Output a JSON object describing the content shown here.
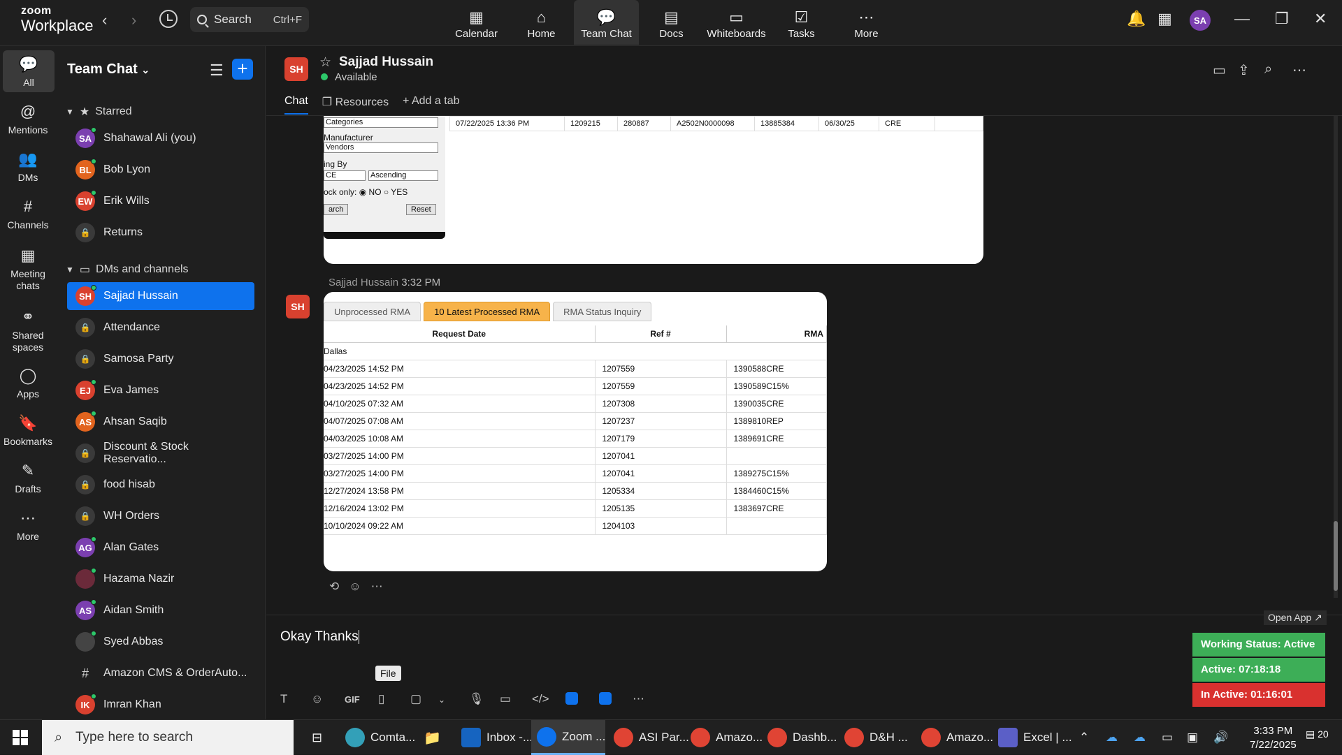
{
  "app": {
    "logo_top": "zoom",
    "logo_bottom": "Workplace"
  },
  "search": {
    "label": "Search",
    "shortcut": "Ctrl+F"
  },
  "top_tabs": [
    {
      "label": "Calendar",
      "icon": "calendar-icon",
      "glyph": "▦"
    },
    {
      "label": "Home",
      "icon": "home-icon",
      "glyph": "⌂"
    },
    {
      "label": "Team Chat",
      "icon": "chat-icon",
      "glyph": "💬"
    },
    {
      "label": "Docs",
      "icon": "docs-icon",
      "glyph": "▤"
    },
    {
      "label": "Whiteboards",
      "icon": "whiteboard-icon",
      "glyph": "▭"
    },
    {
      "label": "Tasks",
      "icon": "tasks-icon",
      "glyph": "☑"
    },
    {
      "label": "More",
      "icon": "more-icon",
      "glyph": "⋯"
    }
  ],
  "user_avatar": "SA",
  "left_nav": [
    {
      "label": "All",
      "glyph": "💬",
      "icon": "all-chat-icon"
    },
    {
      "label": "Mentions",
      "glyph": "@",
      "icon": "mentions-icon"
    },
    {
      "label": "DMs",
      "glyph": "👥",
      "icon": "dms-icon"
    },
    {
      "label": "Channels",
      "glyph": "#",
      "icon": "channels-icon"
    },
    {
      "label": "Meeting chats",
      "glyph": "▦",
      "icon": "meeting-chats-icon"
    },
    {
      "label": "Shared spaces",
      "glyph": "⚭",
      "icon": "shared-spaces-icon"
    },
    {
      "label": "Apps",
      "glyph": "◯",
      "icon": "apps-icon"
    },
    {
      "label": "Bookmarks",
      "glyph": "🔖",
      "icon": "bookmarks-icon"
    },
    {
      "label": "Drafts",
      "glyph": "✎",
      "icon": "drafts-icon"
    },
    {
      "label": "More",
      "glyph": "⋯",
      "icon": "more-icon"
    }
  ],
  "sidebar": {
    "title": "Team Chat",
    "starred_label": "Starred",
    "dms_label": "DMs and channels",
    "starred": [
      {
        "name": "Shahawal Ali (you)",
        "type": "avatar",
        "initials": "SA",
        "color": "#7b3fb0"
      },
      {
        "name": "Bob Lyon",
        "type": "avatar",
        "initials": "BL",
        "color": "#e2641e"
      },
      {
        "name": "Erik Wills",
        "type": "avatar",
        "initials": "EW",
        "color": "#d9412f"
      },
      {
        "name": "Returns",
        "type": "lock"
      }
    ],
    "dms": [
      {
        "name": "Sajjad Hussain",
        "type": "avatar",
        "initials": "SH",
        "color": "#d9412f",
        "selected": true
      },
      {
        "name": "Attendance",
        "type": "lock"
      },
      {
        "name": "Samosa Party",
        "type": "lock"
      },
      {
        "name": "Eva James",
        "type": "avatar",
        "initials": "EJ",
        "color": "#d9412f"
      },
      {
        "name": "Ahsan Saqib",
        "type": "avatar",
        "initials": "AS",
        "color": "#e2641e"
      },
      {
        "name": "Discount & Stock Reservatio...",
        "type": "lock"
      },
      {
        "name": "food hisab",
        "type": "lock"
      },
      {
        "name": "WH Orders",
        "type": "lock"
      },
      {
        "name": "Alan Gates",
        "type": "avatar",
        "initials": "AG",
        "color": "#7b3fb0"
      },
      {
        "name": "Hazama Nazir",
        "type": "avatar",
        "initials": "",
        "color": "#6b2a3a"
      },
      {
        "name": "Aidan Smith",
        "type": "avatar",
        "initials": "AS",
        "color": "#7b3fb0"
      },
      {
        "name": "Syed Abbas",
        "type": "avatar",
        "initials": "",
        "color": "#444"
      },
      {
        "name": "Amazon CMS & OrderAuto...",
        "type": "hash"
      },
      {
        "name": "Imran Khan",
        "type": "avatar",
        "initials": "IK",
        "color": "#d9412f"
      }
    ]
  },
  "chat": {
    "avatar": "SH",
    "name": "Sajjad Hussain",
    "status": "Available",
    "tabs": [
      "Chat",
      "Resources",
      "+ Add a tab"
    ]
  },
  "msg1": {
    "categories": "Categories",
    "manufacturer_label": "Manufacturer",
    "vendors": "Vendors",
    "sorting_label": "ing By",
    "sort_field": "CE",
    "sort_order": "Ascending",
    "stock_label": "ock only:",
    "no": "NO",
    "yes": "YES",
    "search_btn": "arch",
    "reset_btn": "Reset",
    "row": [
      "07/22/2025 13:36 PM",
      "1209215",
      "280887",
      "A2502N0000098",
      "13885384",
      "06/30/25",
      "CRE"
    ]
  },
  "msg2": {
    "sender": "Sajjad Hussain",
    "time": "3:32 PM",
    "avatar": "SH",
    "tabs": [
      "Unprocessed RMA",
      "10 Latest Processed RMA",
      "RMA Status Inquiry"
    ],
    "headers": [
      "Request Date",
      "Ref #",
      "RMA"
    ],
    "group": "Dallas",
    "rows": [
      [
        "04/23/2025 14:52 PM",
        "1207559",
        "1390588CRE"
      ],
      [
        "04/23/2025 14:52 PM",
        "1207559",
        "1390589C15%"
      ],
      [
        "04/10/2025 07:32 AM",
        "1207308",
        "1390035CRE"
      ],
      [
        "04/07/2025 07:08 AM",
        "1207237",
        "1389810REP"
      ],
      [
        "04/03/2025 10:08 AM",
        "1207179",
        "1389691CRE"
      ],
      [
        "03/27/2025 14:00 PM",
        "1207041",
        ""
      ],
      [
        "03/27/2025 14:00 PM",
        "1207041",
        "1389275C15%"
      ],
      [
        "12/27/2024 13:58 PM",
        "1205334",
        "1384460C15%"
      ],
      [
        "12/16/2024 13:02 PM",
        "1205135",
        "1383697CRE"
      ],
      [
        "10/10/2024 09:22 AM",
        "1204103",
        ""
      ]
    ]
  },
  "composer": {
    "text": "Okay Thanks",
    "tooltip": "File",
    "gif": "GIF"
  },
  "widget": {
    "open": "Open App ↗",
    "working": "Working Status: Active",
    "active": "Active: 07:18:18",
    "inactive": "In Active: 01:16:01",
    "colors": {
      "working": "#3dae57",
      "active": "#3dae57",
      "inactive": "#d9312f"
    }
  },
  "taskbar": {
    "search": "Type here to search",
    "apps": [
      "Comta...",
      "Inbox -...",
      "Zoom ...",
      "ASI Par...",
      "Amazo...",
      "Dashb...",
      "D&H ...",
      "Amazo...",
      "Excel | ..."
    ],
    "time": "3:33 PM",
    "date": "7/22/2025",
    "notifications": "20"
  }
}
